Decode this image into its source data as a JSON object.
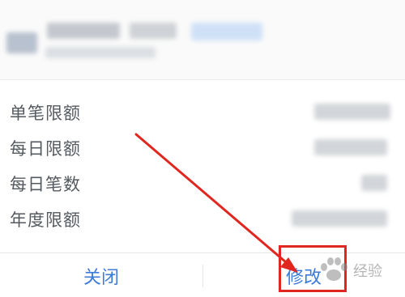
{
  "limits": {
    "rows": [
      {
        "label": "单笔限额"
      },
      {
        "label": "每日限额"
      },
      {
        "label": "每日笔数"
      },
      {
        "label": "年度限额"
      }
    ]
  },
  "actions": {
    "close_label": "关闭",
    "edit_label": "修改"
  },
  "annotation": {
    "color": "#e0261f"
  },
  "watermark": {
    "text": "经验"
  },
  "colors": {
    "accent": "#3d7bd9",
    "label": "#555a60"
  }
}
